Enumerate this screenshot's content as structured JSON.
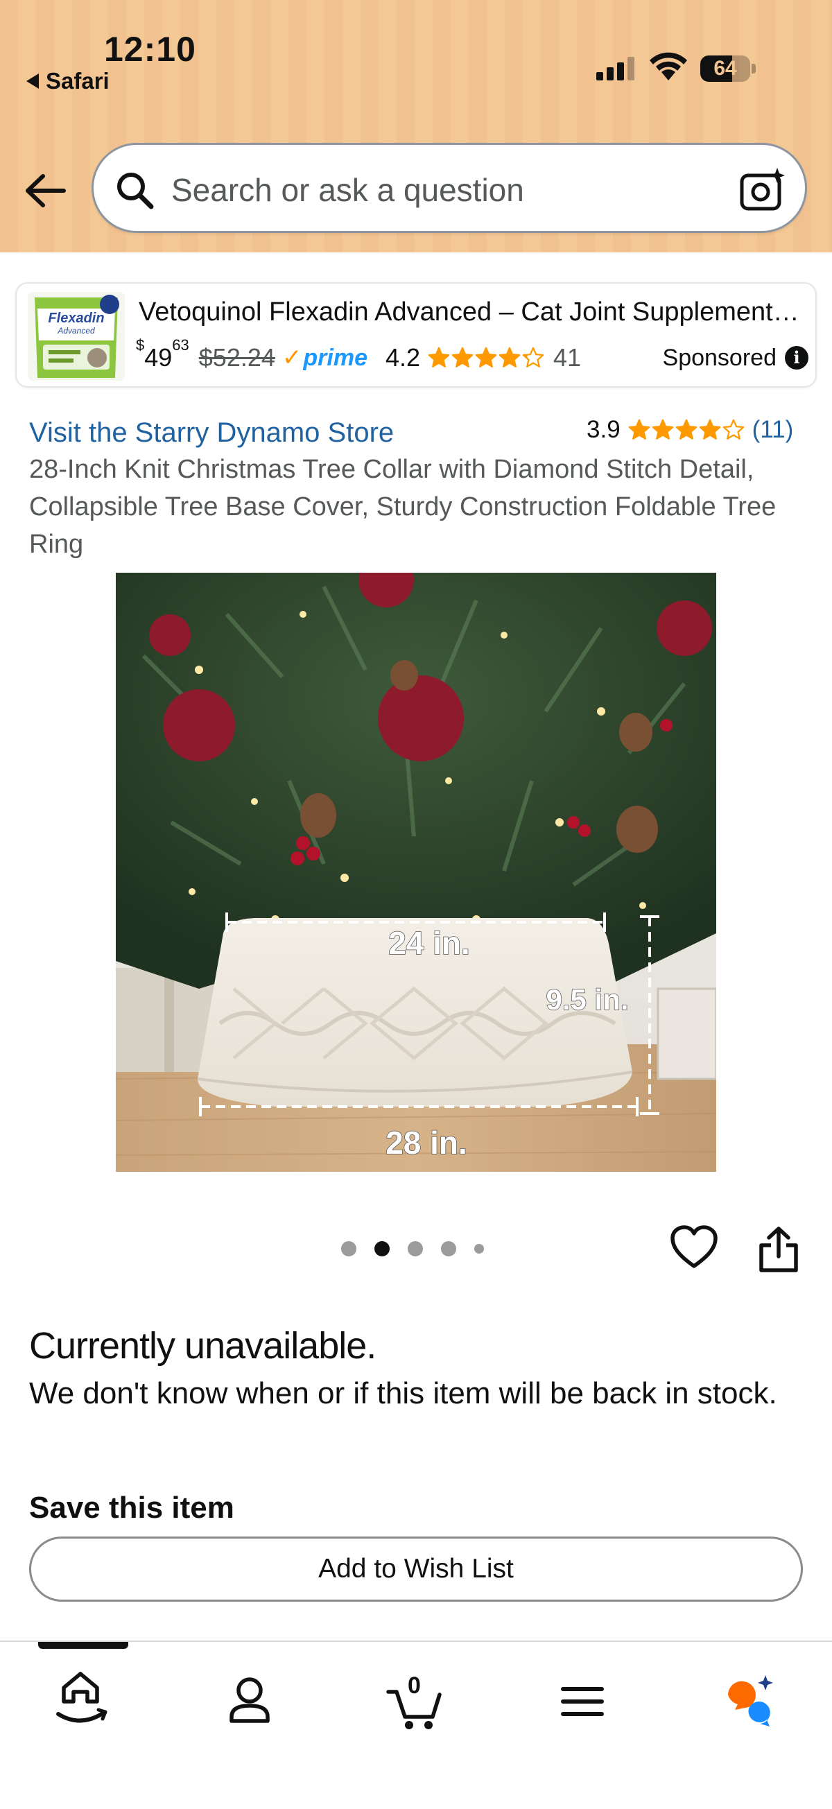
{
  "status_bar": {
    "time": "12:10",
    "back_app": "Safari",
    "battery": "64",
    "battery_level": 0.64
  },
  "search": {
    "placeholder": "Search or ask a question"
  },
  "sponsored": {
    "title": "Vetoquinol Flexadin Advanced – Cat Joint Supplement –...",
    "price_whole": "49",
    "price_fraction": "63",
    "currency": "$",
    "list_price": "$52.24",
    "prime": "prime",
    "rating": "4.2",
    "rating_value": 4.2,
    "review_count": "41",
    "label": "Sponsored",
    "thumb_brand": "Flexadin",
    "thumb_sub": "Advanced"
  },
  "product": {
    "store_link": "Visit the Starry Dynamo Store",
    "rating": "3.9",
    "rating_value": 3.9,
    "rating_count": "(11)",
    "title": "28-Inch Knit Christmas Tree Collar with Diamond Stitch Detail, Collapsible Tree Base Cover, Sturdy Construction Foldable Tree Ring"
  },
  "image_labels": {
    "top_width": "24 in.",
    "height": "9.5 in.",
    "bottom_width": "28 in."
  },
  "gallery": {
    "total": 5,
    "active_index": 1
  },
  "availability": {
    "title": "Currently unavailable.",
    "message": "We don't know when or if this item will be back in stock.",
    "save_title": "Save this item",
    "wish_button": "Add to Wish List"
  },
  "tabbar": {
    "cart_count": "0",
    "tabs": [
      "home",
      "account",
      "cart",
      "menu",
      "rufus"
    ]
  },
  "colors": {
    "header": "#f3c592",
    "link": "#2162a1",
    "star": "#ff9900",
    "prime": "#1a98ff"
  }
}
